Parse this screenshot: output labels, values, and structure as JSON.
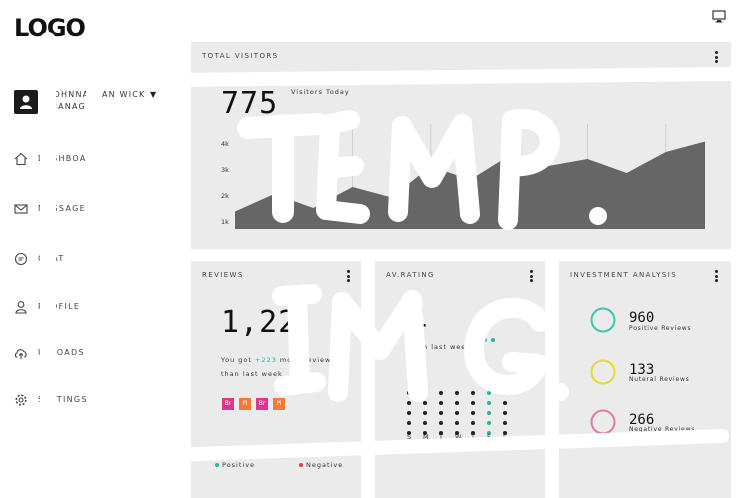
{
  "header": {
    "logo": "LOGO",
    "monitor_icon": "monitor-icon"
  },
  "sidebar": {
    "user": {
      "name": "JOHNNATHAN WICK",
      "role": "MANAGER",
      "caret": "▼"
    },
    "items": [
      {
        "label": "DASHBOARD",
        "icon": "home-icon"
      },
      {
        "label": "MESSAGE",
        "icon": "mail-icon"
      },
      {
        "label": "CHAT",
        "icon": "chat-icon"
      },
      {
        "label": "PROFILE",
        "icon": "user-icon"
      },
      {
        "label": "UPLOADS",
        "icon": "upload-icon"
      },
      {
        "label": "SETTINGS",
        "icon": "gear-icon"
      }
    ]
  },
  "visitors": {
    "title": "TOTAL VISITORS",
    "value": "775",
    "caption": "Visitors Today",
    "y_ticks": [
      "4k",
      "3k",
      "2k",
      "1k"
    ],
    "chart_data": {
      "type": "area",
      "x": [
        0,
        1,
        2,
        3,
        4,
        5,
        6,
        7,
        8,
        9,
        10,
        11,
        12
      ],
      "values": [
        1.5,
        2.0,
        1.6,
        2.2,
        1.9,
        2.8,
        2.4,
        3.1,
        2.8,
        3.0,
        2.6,
        3.2,
        3.5
      ],
      "ylim": [
        1,
        4
      ],
      "grid": true,
      "fill": "#666666"
    }
  },
  "reviews": {
    "title": "REVIEWS",
    "value": "1,22",
    "line1_prefix": "You got ",
    "line1_highlight": "+223",
    "line1_suffix": " more reviews",
    "line2": "than last week",
    "badges": [
      {
        "text": "Br",
        "color": "#e0338a"
      },
      {
        "text": "Pi",
        "color": "#f07b3a"
      },
      {
        "text": "Br",
        "color": "#e0338a"
      },
      {
        "text": "Pi",
        "color": "#f07b3a"
      }
    ],
    "legend": [
      {
        "label": "Positive",
        "color": "#2ab3a0"
      },
      {
        "label": "Negative",
        "color": "#e23a4a"
      }
    ]
  },
  "rating": {
    "title": "AV.RATING",
    "value": "4",
    "caption": "from last week",
    "days": [
      "S",
      "M",
      "T",
      "W",
      "T",
      "F",
      "S"
    ],
    "accent": "#2ab3a0"
  },
  "investment": {
    "title": "INVESTMENT ANALYSIS",
    "rows": [
      {
        "value": "960",
        "label": "Positive Reviews",
        "color": "#3cc5b0"
      },
      {
        "value": "133",
        "label": "Nuteral Reviews",
        "color": "#e5d83a"
      },
      {
        "value": "266",
        "label": "Negative Reviews",
        "color": "#e07aa8"
      }
    ]
  },
  "watermark": {
    "line1": "TEMP.",
    "line2": "IMG."
  }
}
